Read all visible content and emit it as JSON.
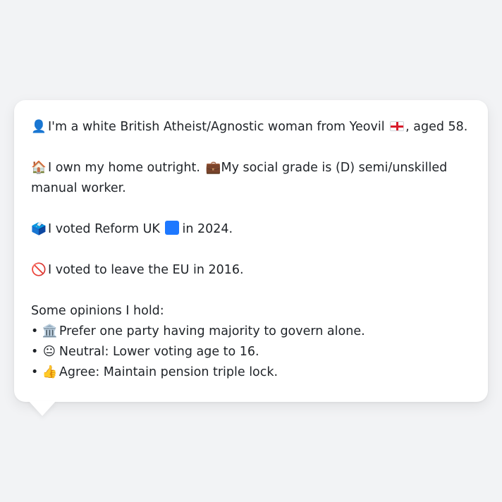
{
  "profile": {
    "identity": {
      "icon": "👤",
      "text_before_flag": "I'm a white British Atheist/Agnostic woman from Yeovil",
      "flag_icon": "england-flag-icon",
      "text_after_flag": ", aged 58."
    },
    "home_work": {
      "home_icon": "🏠",
      "home_text": "I own my home outright.",
      "work_icon": "💼",
      "work_text": "My social grade is (D) semi/unskilled manual worker."
    },
    "vote_2024": {
      "icon": "🗳️",
      "text_before": "I voted Reform UK",
      "party_color": "#1e78ff",
      "text_after": "in 2024."
    },
    "vote_eu": {
      "icon": "🚫",
      "text": "I voted to leave the EU in 2016."
    },
    "opinions_heading": "Some opinions I hold:",
    "opinions": [
      {
        "bullet": "•",
        "icon": "🏛️",
        "text": "Prefer one party having majority to govern alone."
      },
      {
        "bullet": "•",
        "icon": "😐",
        "text": "Neutral: Lower voting age to 16."
      },
      {
        "bullet": "•",
        "icon": "👍",
        "text": "Agree: Maintain pension triple lock."
      }
    ]
  }
}
